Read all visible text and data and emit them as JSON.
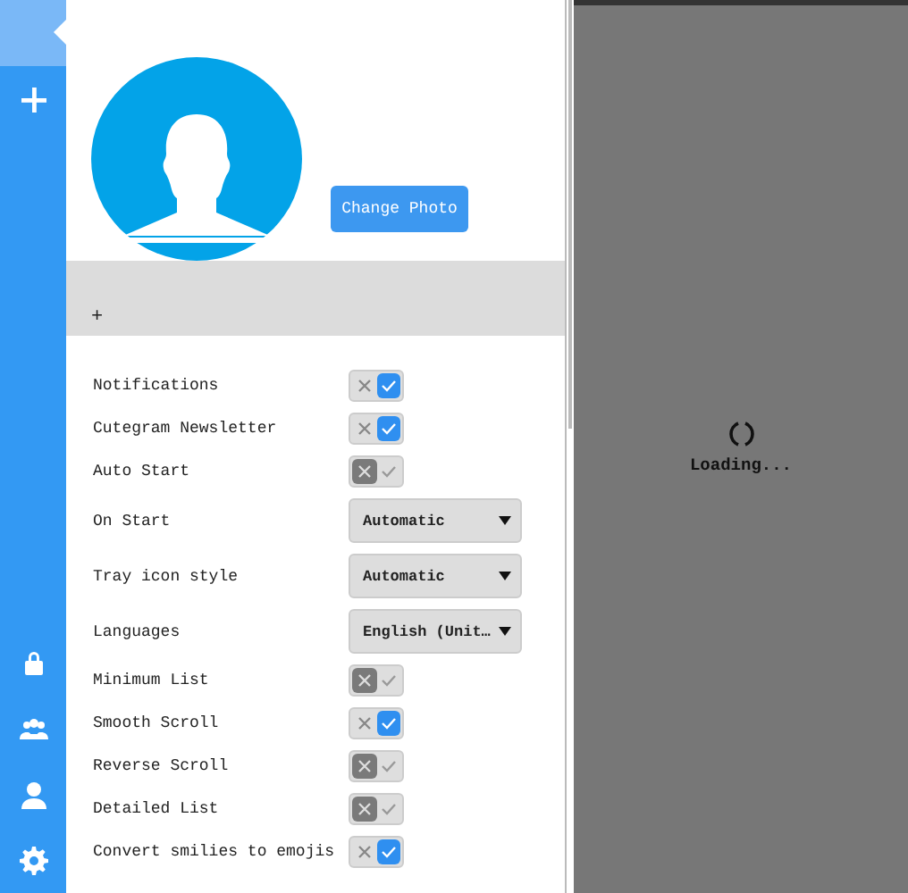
{
  "sidebar": {
    "items": [
      {
        "kind": "profile",
        "selected": true
      },
      {
        "kind": "add",
        "selected": false
      },
      {
        "kind": "lock",
        "selected": false
      },
      {
        "kind": "group",
        "selected": false
      },
      {
        "kind": "user",
        "selected": false
      },
      {
        "kind": "settings",
        "selected": false
      }
    ]
  },
  "profile": {
    "change_photo_button": "Change Photo"
  },
  "band": {
    "label": "+"
  },
  "settings": [
    {
      "kind": "toggle",
      "label": "Notifications",
      "on": true
    },
    {
      "kind": "toggle",
      "label": "Cutegram Newsletter",
      "on": true
    },
    {
      "kind": "toggle",
      "label": "Auto Start",
      "on": false
    },
    {
      "kind": "select",
      "label": "On Start",
      "value": "Automatic"
    },
    {
      "kind": "select",
      "label": "Tray icon style",
      "value": "Automatic"
    },
    {
      "kind": "select",
      "label": "Languages",
      "value": "English (Unit…"
    },
    {
      "kind": "toggle",
      "label": "Minimum List",
      "on": false
    },
    {
      "kind": "toggle",
      "label": "Smooth Scroll",
      "on": true
    },
    {
      "kind": "toggle",
      "label": "Reverse Scroll",
      "on": false
    },
    {
      "kind": "toggle",
      "label": "Detailed List",
      "on": false
    },
    {
      "kind": "toggle",
      "label": "Convert smilies to emojis",
      "on": true
    }
  ],
  "loading": {
    "text": "Loading..."
  }
}
